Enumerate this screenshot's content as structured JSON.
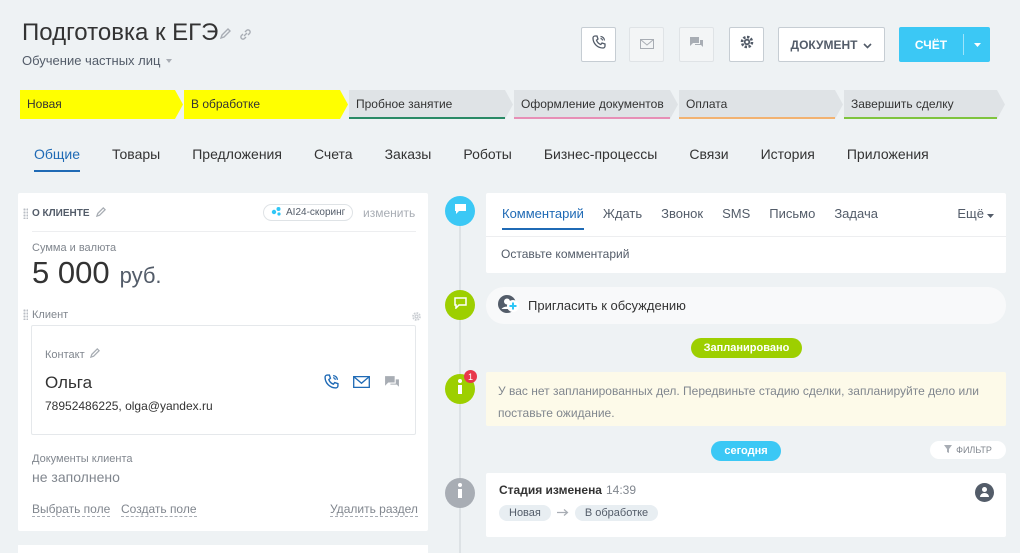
{
  "header": {
    "title": "Подготовка к ЕГЭ",
    "category": "Обучение частных лиц",
    "document_label": "ДОКУМЕНТ",
    "bill_label": "СЧЁТ"
  },
  "stages": [
    {
      "label": "Новая",
      "color": "#ffff00",
      "bar": "#ffff00"
    },
    {
      "label": "В обработке",
      "color": "#ffff00",
      "bar": "#ffff00"
    },
    {
      "label": "Пробное занятие",
      "color": "#dfe3e6",
      "bar": "#2a8a66"
    },
    {
      "label": "Оформление документов",
      "color": "#dfe3e6",
      "bar": "#e78fb6"
    },
    {
      "label": "Оплата",
      "color": "#dfe3e6",
      "bar": "#f2b271"
    },
    {
      "label": "Завершить сделку",
      "color": "#dfe3e6",
      "bar": "#7fc43e"
    }
  ],
  "tabs": [
    "Общие",
    "Товары",
    "Предложения",
    "Счета",
    "Заказы",
    "Роботы",
    "Бизнес-процессы",
    "Связи",
    "История",
    "Приложения"
  ],
  "client_section": {
    "title": "О КЛИЕНТЕ",
    "ai_badge": "AI24-скоринг",
    "edit": "изменить",
    "amount_label": "Сумма и валюта",
    "amount": "5 000",
    "currency": "руб.",
    "client_label": "Клиент",
    "contact_label": "Контакт",
    "contact_name": "Ольга",
    "contact_info": "78952486225, olga@yandex.ru",
    "docs_label": "Документы клиента",
    "docs_value": "не заполнено",
    "select_field": "Выбрать поле",
    "create_field": "Создать поле",
    "delete_section": "Удалить раздел"
  },
  "comment": {
    "tabs": [
      "Комментарий",
      "Ждать",
      "Звонок",
      "SMS",
      "Письмо",
      "Задача"
    ],
    "more": "Ещё",
    "placeholder": "Оставьте комментарий"
  },
  "invite": "Пригласить к обсуждению",
  "planned_label": "Запланировано",
  "notice_count": "1",
  "notice": "У вас нет запланированных дел. Передвиньте стадию сделки, запланируйте дело или поставьте ожидание.",
  "today_label": "сегодня",
  "filter_label": "ФИЛЬТР",
  "event": {
    "title": "Стадия изменена",
    "time": "14:39",
    "from": "Новая",
    "to": "В обработке"
  }
}
